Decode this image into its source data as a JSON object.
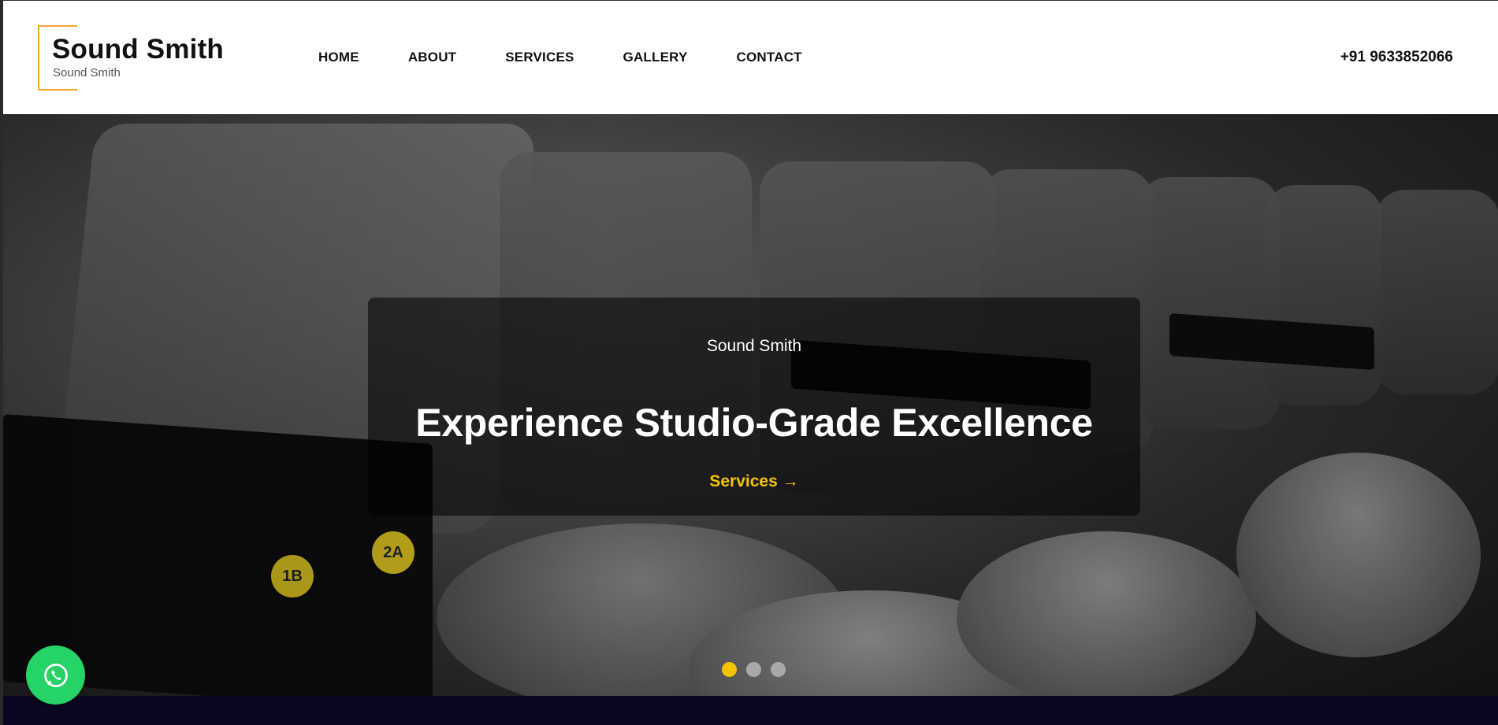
{
  "brand": {
    "title": "Sound Smith",
    "subtitle": "Sound Smith"
  },
  "nav": {
    "items": [
      {
        "label": "HOME"
      },
      {
        "label": "ABOUT"
      },
      {
        "label": "SERVICES"
      },
      {
        "label": "GALLERY"
      },
      {
        "label": "CONTACT"
      }
    ]
  },
  "header": {
    "phone": "+91 9633852066"
  },
  "hero": {
    "kicker": "Sound Smith",
    "title": "Experience Studio-Grade Excellence",
    "cta_label": "Services →",
    "seat_tags": [
      "1B",
      "2A"
    ],
    "slides": {
      "total": 3,
      "active_index": 0
    }
  },
  "colors": {
    "accent": "#f5c400",
    "logo_frame": "#f5a623",
    "whatsapp": "#25d366",
    "footer": "#0a0520"
  },
  "icons": {
    "whatsapp": "whatsapp-icon"
  }
}
